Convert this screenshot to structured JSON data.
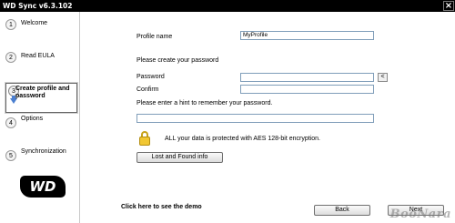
{
  "window": {
    "title": "WD Sync v6.3.102",
    "close_glyph": "×"
  },
  "steps": [
    {
      "num": "1",
      "label": "Welcome"
    },
    {
      "num": "2",
      "label": "Read EULA"
    },
    {
      "num": "3",
      "label": "Create profile and password"
    },
    {
      "num": "4",
      "label": "Options"
    },
    {
      "num": "5",
      "label": "Synchronization"
    }
  ],
  "logo": {
    "text": "WD"
  },
  "form": {
    "profile_name_label": "Profile name",
    "profile_name_value": "MyProfile",
    "create_password_prompt": "Please create your password",
    "password_label": "Password",
    "password_value": "",
    "reveal_button_label": "<",
    "confirm_label": "Confirm",
    "confirm_value": "",
    "hint_prompt": "Please enter a hint to remember your password.",
    "hint_value": "",
    "encryption_note": "ALL your data is protected with AES 128-bit encryption.",
    "lost_found_label": "Lost and Found info"
  },
  "footer": {
    "demo_link": "Click here to see the demo",
    "back_label": "Back",
    "next_label": "Next"
  },
  "watermark": "BooNara"
}
